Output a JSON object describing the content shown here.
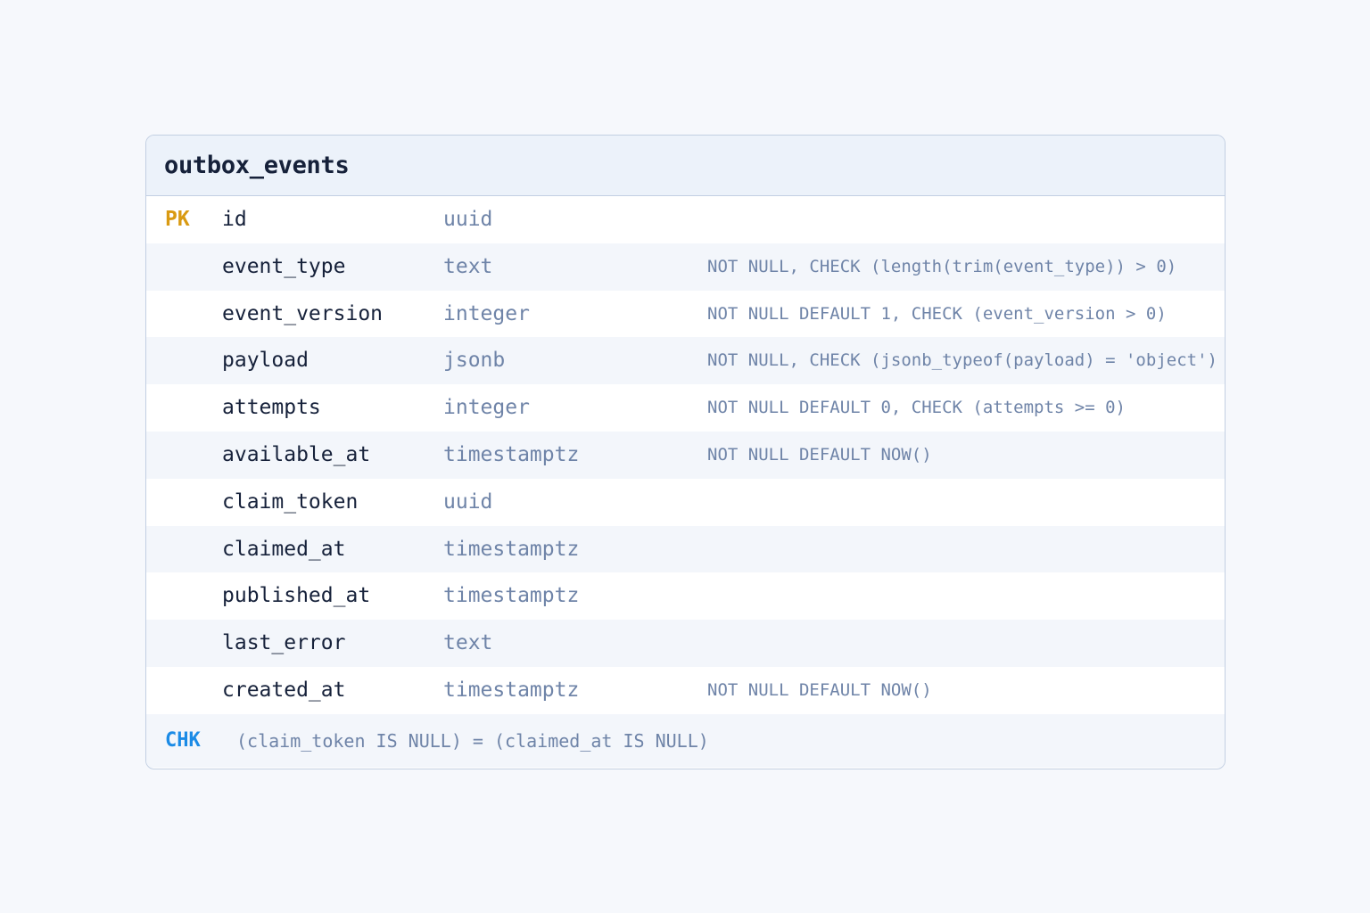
{
  "table": {
    "name": "outbox_events",
    "columns": [
      {
        "key": "PK",
        "name": "id",
        "type": "uuid",
        "constraint": ""
      },
      {
        "key": "",
        "name": "event_type",
        "type": "text",
        "constraint": "NOT NULL, CHECK (length(trim(event_type)) > 0)"
      },
      {
        "key": "",
        "name": "event_version",
        "type": "integer",
        "constraint": "NOT NULL DEFAULT 1, CHECK (event_version > 0)"
      },
      {
        "key": "",
        "name": "payload",
        "type": "jsonb",
        "constraint": "NOT NULL, CHECK (jsonb_typeof(payload) = 'object')"
      },
      {
        "key": "",
        "name": "attempts",
        "type": "integer",
        "constraint": "NOT NULL DEFAULT 0, CHECK (attempts >= 0)"
      },
      {
        "key": "",
        "name": "available_at",
        "type": "timestamptz",
        "constraint": "NOT NULL DEFAULT NOW()"
      },
      {
        "key": "",
        "name": "claim_token",
        "type": "uuid",
        "constraint": ""
      },
      {
        "key": "",
        "name": "claimed_at",
        "type": "timestamptz",
        "constraint": ""
      },
      {
        "key": "",
        "name": "published_at",
        "type": "timestamptz",
        "constraint": ""
      },
      {
        "key": "",
        "name": "last_error",
        "type": "text",
        "constraint": ""
      },
      {
        "key": "",
        "name": "created_at",
        "type": "timestamptz",
        "constraint": "NOT NULL DEFAULT NOW()"
      }
    ],
    "check": {
      "label": "CHK",
      "expression": "(claim_token IS NULL) = (claimed_at IS NULL)"
    }
  },
  "colors": {
    "pk_badge": "#d99a12",
    "chk_badge": "#1b8be6",
    "column_name": "#16213a",
    "type_and_constraint": "#6f84a8",
    "header_bg": "#ecf2fa",
    "border": "#c2cfe2"
  }
}
